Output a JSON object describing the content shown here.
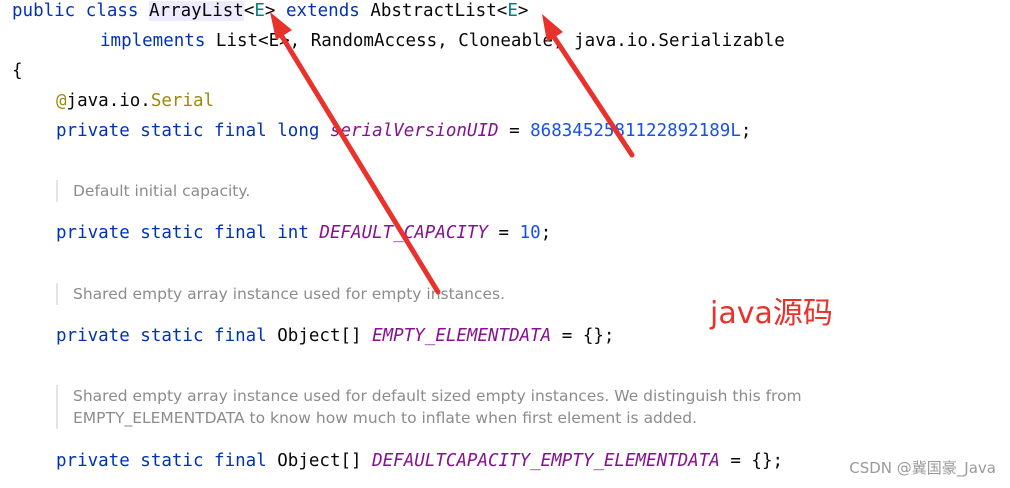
{
  "code": {
    "line1": {
      "public": "public",
      "class": "class",
      "name": "ArrayList",
      "lt": "<",
      "e": "E",
      "gt": ">",
      "extends": "extends",
      "parent": "AbstractList",
      "lt2": "<",
      "e2": "E",
      "gt2": ">"
    },
    "line2": {
      "implements": "implements",
      "list": "List<E>, RandomAccess, Cloneable, java.io.Serializable"
    },
    "brace": "{",
    "annotation": {
      "at": "@",
      "pkg": "java.io.",
      "name": "Serial"
    },
    "line_uid": {
      "mods": "private static final long",
      "name": "serialVersionUID",
      "eq": " = ",
      "value": "8683452581122892189L",
      "end": ";"
    },
    "line_cap": {
      "mods": "private static final int",
      "name": "DEFAULT_CAPACITY",
      "eq": " = ",
      "value": "10",
      "end": ";"
    },
    "line_empty": {
      "mods": "private static final",
      "type": "Object[]",
      "name": "EMPTY_ELEMENTDATA",
      "rest": " = {};"
    },
    "line_default": {
      "mods": "private static final",
      "type": "Object[]",
      "name": "DEFAULTCAPACITY_EMPTY_ELEMENTDATA",
      "rest": " = {};"
    }
  },
  "docs": {
    "cap": "Default initial capacity.",
    "empty": "Shared empty array instance used for empty instances.",
    "default_line1": "Shared empty array instance used for default sized empty instances. We distinguish this from",
    "default_line2": "EMPTY_ELEMENTDATA to know how much to inflate when first element is added."
  },
  "annotation_label": "java源码",
  "watermark": "CSDN @冀国豪_Java",
  "colors": {
    "keyword": "#0033b3",
    "type_param": "#067d80",
    "constant": "#871094",
    "number": "#1750eb",
    "annotation": "#9e880d",
    "doc": "#8c8c8c",
    "arrow": "#e8322b"
  }
}
